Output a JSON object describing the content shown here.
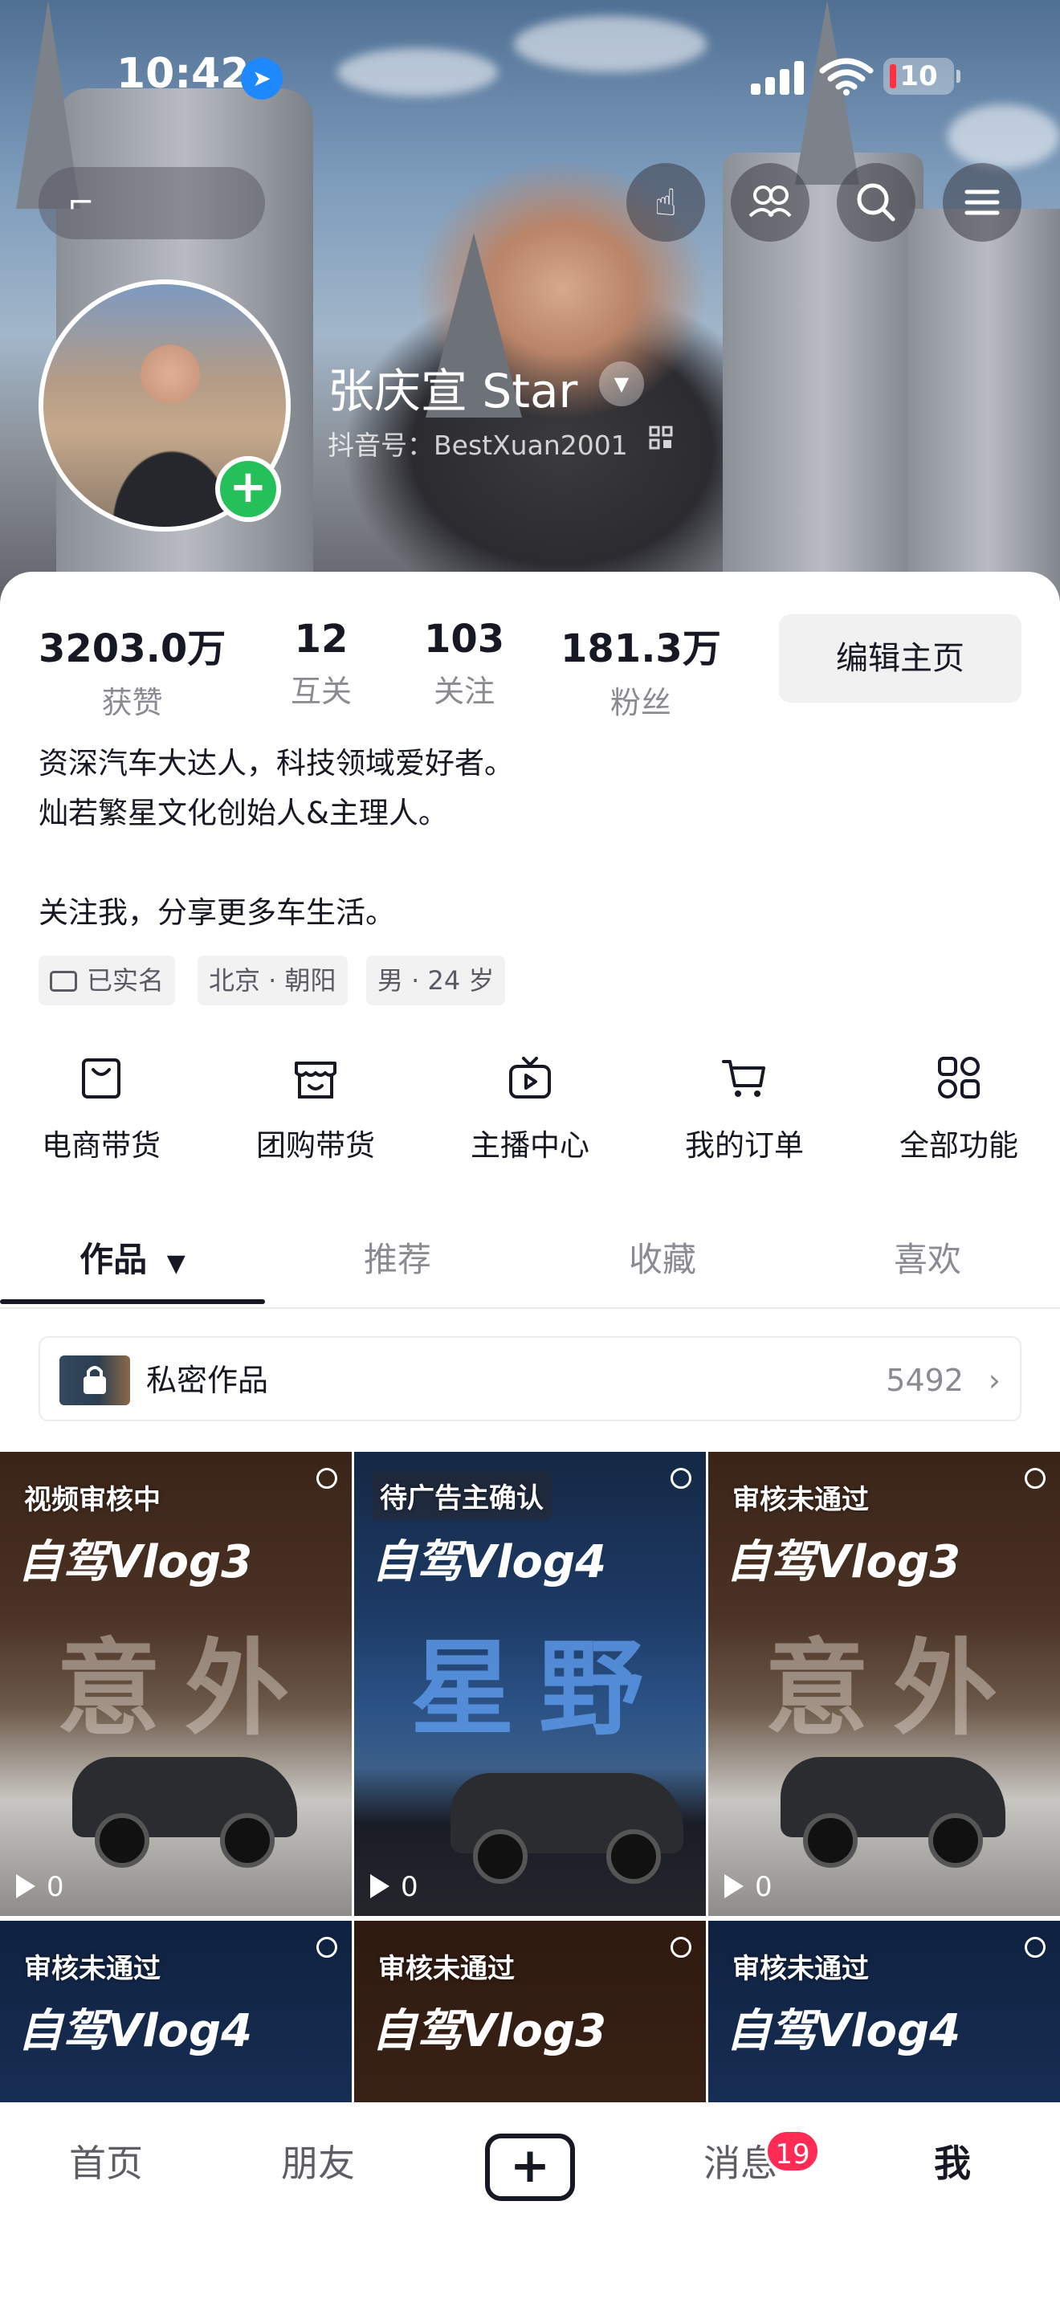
{
  "status_bar": {
    "time": "10:42",
    "battery": "10"
  },
  "header": {
    "back_label": "⌐",
    "buttons": [
      {
        "name": "hand-pointer-icon",
        "glyph": "☝"
      },
      {
        "name": "friends-icon",
        "glyph": "👥"
      },
      {
        "name": "search-icon",
        "glyph": "⌕"
      },
      {
        "name": "menu-icon",
        "glyph": "☰"
      }
    ]
  },
  "profile": {
    "nickname": "张庆宣 Star",
    "douyin_id": "抖音号：BestXuan2001"
  },
  "stats": [
    {
      "value": "3203.0万",
      "label": "获赞"
    },
    {
      "value": "12",
      "label": "互关"
    },
    {
      "value": "103",
      "label": "关注"
    },
    {
      "value": "181.3万",
      "label": "粉丝"
    }
  ],
  "edit_button": "编辑主页",
  "bio": {
    "line1": "资深汽车大达人，科技领域爱好者。",
    "line2": "灿若繁星文化创始人&主理人。",
    "line3": "",
    "line4": "关注我，分享更多车生活。"
  },
  "tags": {
    "verified": "已实名",
    "location": "北京 · 朝阳",
    "gender_age": "男 · 24 岁"
  },
  "functions": [
    {
      "label": "电商带货",
      "icon": "shopping-bag-icon"
    },
    {
      "label": "团购带货",
      "icon": "store-icon"
    },
    {
      "label": "主播中心",
      "icon": "live-tv-icon"
    },
    {
      "label": "我的订单",
      "icon": "cart-icon"
    },
    {
      "label": "全部功能",
      "icon": "grid-apps-icon"
    }
  ],
  "tabs": {
    "works": "作品",
    "recommend": "推荐",
    "favorites": "收藏",
    "likes": "喜欢"
  },
  "private_works": {
    "label": "私密作品",
    "count": "5492"
  },
  "videos": [
    {
      "status": "视频审核中",
      "title": "自驾Vlog3",
      "big": "意外",
      "plays": "0"
    },
    {
      "status": "待广告主确认",
      "title": "自驾Vlog4",
      "big": "星野",
      "plays": "0"
    },
    {
      "status": "审核未通过",
      "title": "自驾Vlog3",
      "big": "意外",
      "plays": "0"
    },
    {
      "status": "审核未通过",
      "title": "自驾Vlog4"
    },
    {
      "status": "审核未通过",
      "title": "自驾Vlog3"
    },
    {
      "status": "审核未通过",
      "title": "自驾Vlog4"
    }
  ],
  "bottom_nav": {
    "home": "首页",
    "friends": "朋友",
    "create": "+",
    "messages": "消息",
    "messages_badge": "19",
    "me": "我"
  },
  "colors": {
    "accent_red": "#fe2c55",
    "plus_green": "#25c05a",
    "text_primary": "#161823",
    "text_secondary": "#8a8b91"
  }
}
